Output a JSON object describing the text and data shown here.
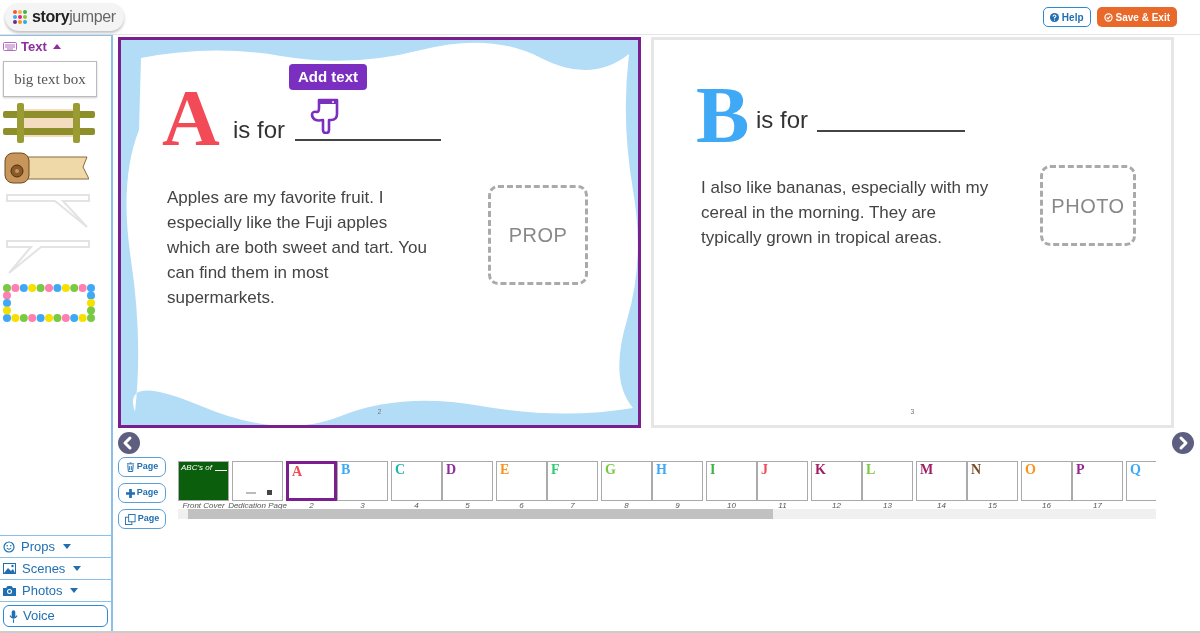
{
  "header": {
    "logo": "**story**jumper",
    "buttons": [
      {
        "kind": "help",
        "label": "Help"
      },
      {
        "kind": "save",
        "label": "Save & Exit"
      }
    ]
  },
  "sidebar": {
    "text_section": {
      "label": "Text",
      "expanded": true,
      "items": [
        {
          "kind": "text_box",
          "label": "big text box"
        },
        {
          "kind": "bamboo"
        },
        {
          "kind": "scroll"
        },
        {
          "kind": "bubble_right"
        },
        {
          "kind": "bubble_left"
        },
        {
          "kind": "stars"
        }
      ]
    },
    "sections": [
      {
        "kind": "props",
        "label": "Props",
        "expanded": false
      },
      {
        "kind": "scenes",
        "label": "Scenes",
        "expanded": false
      },
      {
        "kind": "photos",
        "label": "Photos",
        "expanded": false
      }
    ],
    "voice_button": "Voice"
  },
  "pages": [
    {
      "letter": "A",
      "color": "#f24a57",
      "is_for": "is for",
      "text": "Apples are my favorite fruit. I especially like the Fuji apples which are both sweet and tart. You can find them in most supermarkets.",
      "placeholder": "PROP",
      "number": "2",
      "selected": true,
      "frame": true,
      "tooltip": "Add text"
    },
    {
      "letter": "B",
      "color": "#3fa9f5",
      "is_for": "is for",
      "text": "I also like bananas, especially with my cereal in the morning. They are typically grown in tropical areas.",
      "placeholder": "PHOTO",
      "number": "3",
      "selected": false,
      "frame": false
    }
  ],
  "page_buttons": [
    {
      "kind": "delete",
      "label": "Page"
    },
    {
      "kind": "add",
      "label": "Page"
    },
    {
      "kind": "copy",
      "label": "Page"
    }
  ],
  "thumbnails": [
    {
      "kind": "cover",
      "title": "ABC's of",
      "label": "Front Cover",
      "selected": false
    },
    {
      "kind": "dedication",
      "label": "Dedication Page",
      "selected": false
    },
    {
      "kind": "letter",
      "letter": "A",
      "color": "#f24a57",
      "label": "2",
      "selected": true
    },
    {
      "kind": "letter",
      "letter": "B",
      "color": "#3fa9f5",
      "label": "3",
      "selected": false
    },
    {
      "kind": "letter",
      "letter": "C",
      "color": "#1fb5a8",
      "label": "4",
      "selected": false
    },
    {
      "kind": "letter",
      "letter": "D",
      "color": "#8e2d9c",
      "label": "5",
      "selected": false
    },
    {
      "kind": "letter",
      "letter": "E",
      "color": "#f7941d",
      "label": "6",
      "selected": false
    },
    {
      "kind": "letter",
      "letter": "F",
      "color": "#2ecc71",
      "label": "7",
      "selected": false
    },
    {
      "kind": "letter",
      "letter": "G",
      "color": "#7ac943",
      "label": "8",
      "selected": false
    },
    {
      "kind": "letter",
      "letter": "H",
      "color": "#3fa9f5",
      "label": "9",
      "selected": false
    },
    {
      "kind": "letter",
      "letter": "I",
      "color": "#39b54a",
      "label": "10",
      "selected": false
    },
    {
      "kind": "letter",
      "letter": "J",
      "color": "#f24a57",
      "label": "11",
      "selected": false
    },
    {
      "kind": "letter",
      "letter": "K",
      "color": "#9e1f63",
      "label": "12",
      "selected": false
    },
    {
      "kind": "letter",
      "letter": "L",
      "color": "#7ac943",
      "label": "13",
      "selected": false
    },
    {
      "kind": "letter",
      "letter": "M",
      "color": "#9e1f63",
      "label": "14",
      "selected": false
    },
    {
      "kind": "letter",
      "letter": "N",
      "color": "#754c24",
      "label": "15",
      "selected": false
    },
    {
      "kind": "letter",
      "letter": "O",
      "color": "#f7941d",
      "label": "16",
      "selected": false
    },
    {
      "kind": "letter",
      "letter": "P",
      "color": "#93278f",
      "label": "17",
      "selected": false
    },
    {
      "kind": "letter",
      "letter": "Q",
      "color": "#3fa9f5",
      "selected": false
    }
  ]
}
